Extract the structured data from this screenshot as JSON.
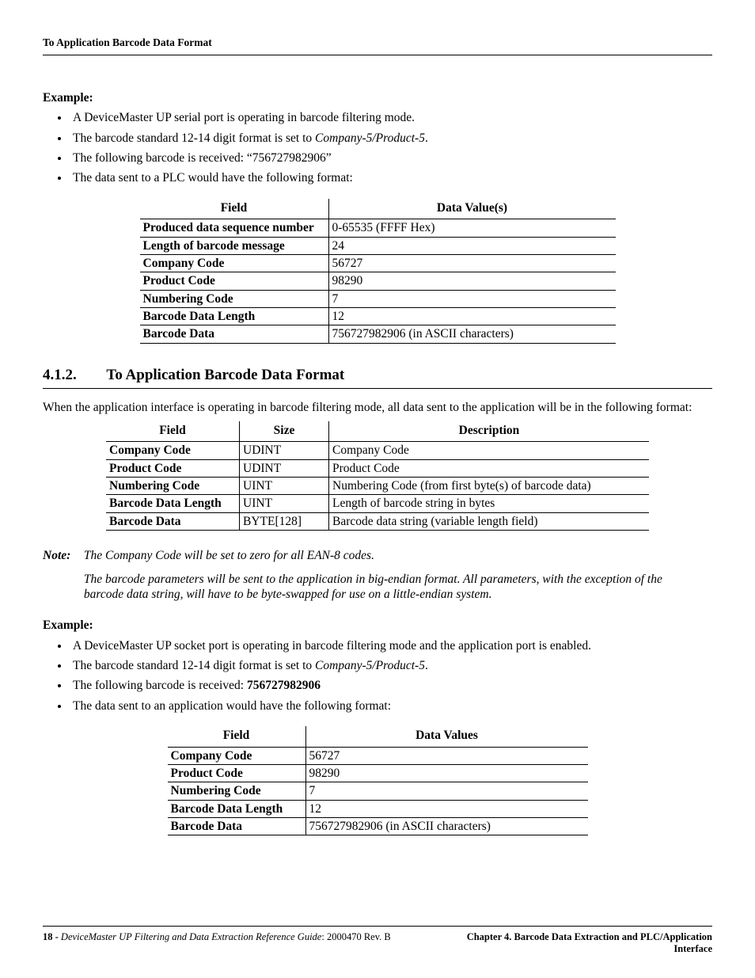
{
  "header": {
    "running_title": "To Application Barcode Data Format"
  },
  "example1": {
    "label": "Example:",
    "bullets": [
      {
        "text": "A DeviceMaster UP serial port is operating in barcode filtering mode."
      },
      {
        "prefix": "The barcode standard 12-14 digit format is set to ",
        "em": "Company-5/Product-5",
        "suffix": "."
      },
      {
        "text": "The following barcode is received: “756727982906”"
      },
      {
        "text": "The data sent to a PLC would have the following format:"
      }
    ]
  },
  "table1": {
    "head": [
      "Field",
      "Data Value(s)"
    ],
    "rows": [
      [
        "Produced data sequence number",
        "0-65535 (FFFF Hex)"
      ],
      [
        "Length of barcode message",
        "24"
      ],
      [
        "Company Code",
        "56727"
      ],
      [
        "Product Code",
        "98290"
      ],
      [
        "Numbering Code",
        "7"
      ],
      [
        "Barcode Data Length",
        "12"
      ],
      [
        "Barcode Data",
        "756727982906 (in ASCII characters)"
      ]
    ]
  },
  "section": {
    "number": "4.1.2.",
    "title": "To Application Barcode Data Format",
    "intro": "When the application interface is operating in barcode filtering mode, all data sent to the application will be in the following format:"
  },
  "table2": {
    "head": [
      "Field",
      "Size",
      "Description"
    ],
    "rows": [
      [
        "Company Code",
        "UDINT",
        "Company Code"
      ],
      [
        "Product Code",
        "UDINT",
        "Product Code"
      ],
      [
        "Numbering Code",
        "UINT",
        "Numbering Code (from first byte(s) of barcode data)"
      ],
      [
        "Barcode Data Length",
        "UINT",
        "Length of barcode string in bytes"
      ],
      [
        "Barcode Data",
        "BYTE[128]",
        "Barcode data string (variable length field)"
      ]
    ]
  },
  "note": {
    "label": "Note:",
    "paras": [
      "The Company Code will be set to zero for all EAN-8 codes.",
      "The barcode parameters will be sent to the application in big-endian format. All parameters, with the exception of the barcode data string, will have to be byte-swapped for use on a little-endian system."
    ]
  },
  "example2": {
    "label": "Example:",
    "bullets": [
      {
        "text": "A DeviceMaster UP socket port is operating in barcode filtering mode and the application port is enabled."
      },
      {
        "prefix": "The barcode standard 12-14 digit format is set to ",
        "em": "Company-5/Product-5",
        "suffix": "."
      },
      {
        "prefix": "The following barcode is received: ",
        "bold": "756727982906"
      },
      {
        "text": "The data sent to an application would have the following format:"
      }
    ]
  },
  "table3": {
    "head": [
      "Field",
      "Data Values"
    ],
    "rows": [
      [
        "Company Code",
        "56727"
      ],
      [
        "Product Code",
        "98290"
      ],
      [
        "Numbering Code",
        "7"
      ],
      [
        "Barcode Data Length",
        "12"
      ],
      [
        "Barcode Data",
        "756727982906 (in ASCII characters)"
      ]
    ]
  },
  "footer": {
    "page": "18 - ",
    "doc_title": "DeviceMaster UP Filtering and Data Extraction Reference Guide",
    "doc_rev": ": 2000470 Rev. B",
    "chapter": "Chapter 4. Barcode Data Extraction and PLC/Application Interface"
  }
}
